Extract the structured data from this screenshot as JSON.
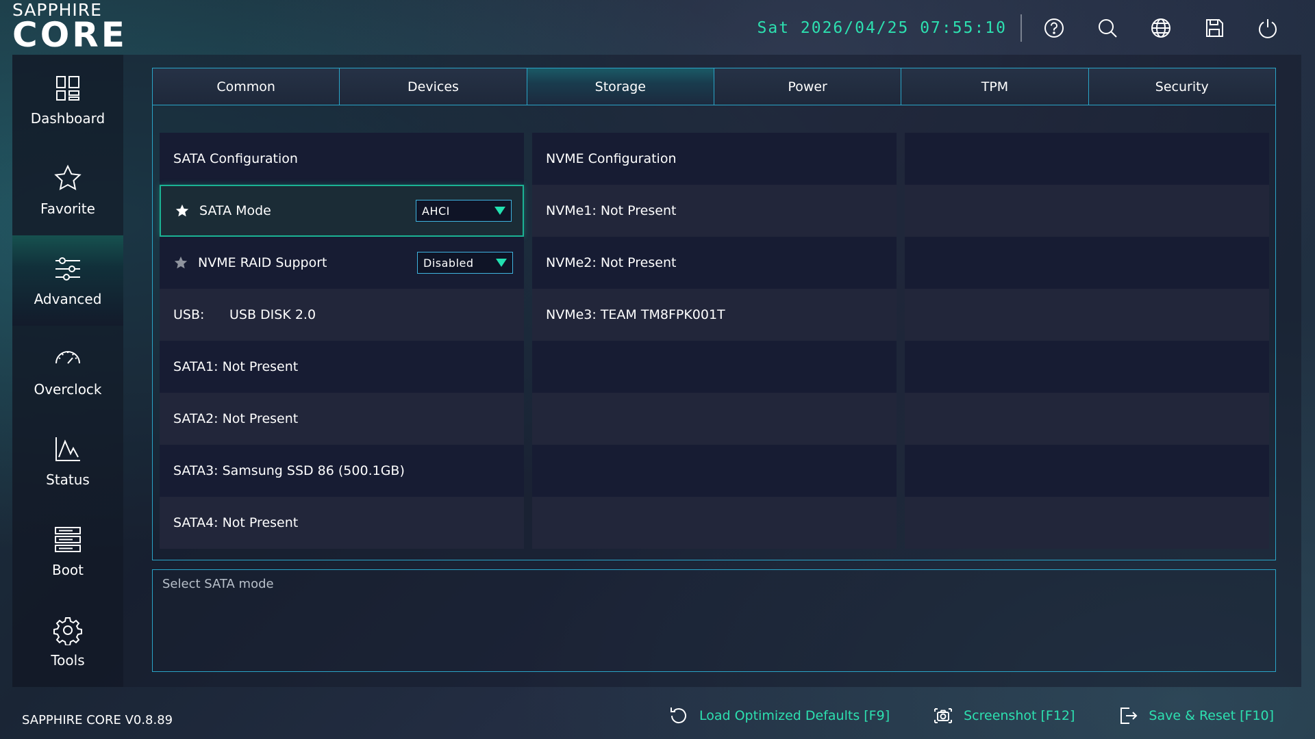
{
  "brand": {
    "top": "SAPPHIRE",
    "main": "CORE"
  },
  "header": {
    "datetime": "Sat 2026/04/25 07:55:10",
    "icons": [
      "help-icon",
      "search-icon",
      "globe-icon",
      "save-icon",
      "power-icon"
    ]
  },
  "sidebar": {
    "items": [
      {
        "label": "Dashboard",
        "icon": "dashboard-icon"
      },
      {
        "label": "Favorite",
        "icon": "star-icon"
      },
      {
        "label": "Advanced",
        "icon": "sliders-icon",
        "active": true
      },
      {
        "label": "Overclock",
        "icon": "gauge-icon"
      },
      {
        "label": "Status",
        "icon": "chart-icon"
      },
      {
        "label": "Boot",
        "icon": "server-icon"
      },
      {
        "label": "Tools",
        "icon": "gear-icon"
      }
    ]
  },
  "tabs": [
    "Common",
    "Devices",
    "Storage",
    "Power",
    "TPM",
    "Security"
  ],
  "active_tab": "Storage",
  "storage": {
    "col1": {
      "heading": "SATA Configuration",
      "sata_mode": {
        "label": "SATA Mode",
        "value": "AHCI",
        "favorite": true
      },
      "nvme_raid": {
        "label": "NVME RAID Support",
        "value": "Disabled",
        "favorite": false
      },
      "usb": {
        "label": "USB:",
        "value": "USB DISK 2.0"
      },
      "sata1": "SATA1: Not Present",
      "sata2": "SATA2: Not Present",
      "sata3": "SATA3: Samsung SSD 86 (500.1GB)",
      "sata4": "SATA4: Not Present"
    },
    "col2": {
      "heading": "NVME Configuration",
      "nvme1": "NVMe1: Not Present",
      "nvme2": "NVMe2: Not Present",
      "nvme3": "NVMe3: TEAM TM8FPK001T"
    }
  },
  "help_text": "Select SATA mode",
  "footer": {
    "version": "SAPPHIRE CORE V0.8.89",
    "load_defaults": "Load Optimized Defaults [F9]",
    "screenshot": "Screenshot [F12]",
    "save_reset": "Save & Reset [F10]"
  },
  "colors": {
    "accent": "#2de0b0",
    "border": "#2aa5c8",
    "active_cell_border": "#1bb394"
  }
}
